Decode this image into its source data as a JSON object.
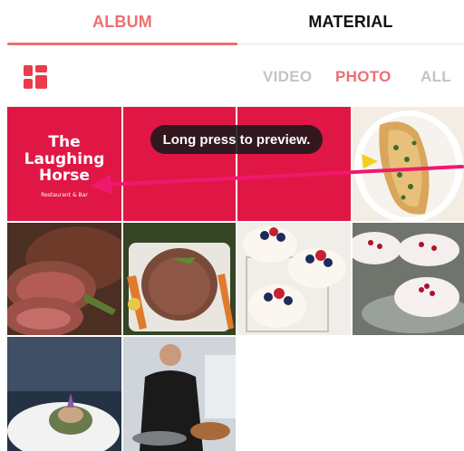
{
  "tabs": {
    "album": "ALBUM",
    "material": "MATERIAL",
    "active": "album"
  },
  "filters": {
    "video": "VIDEO",
    "photo": "PHOTO",
    "all": "ALL",
    "selected": "photo"
  },
  "tooltip": "Long press to preview.",
  "logo": {
    "line1": "The",
    "line2": "Laughing",
    "line3": "Horse",
    "tagline": "Restaurant & Bar"
  },
  "colors": {
    "accent": "#ec6f73",
    "brand_red": "#e01745",
    "icon_red": "#ec3b4b",
    "arrow": "#f0196e",
    "inactive": "#c4c4c4"
  },
  "icons": {
    "layout_toggle": "grid-layout-icon"
  },
  "grid": {
    "columns": 4,
    "items": [
      {
        "type": "photo",
        "subject": "logo-tile"
      },
      {
        "type": "photo",
        "subject": "red-tile"
      },
      {
        "type": "photo",
        "subject": "red-tile"
      },
      {
        "type": "photo",
        "subject": "grilled-fish"
      },
      {
        "type": "photo",
        "subject": "roast-beef"
      },
      {
        "type": "photo",
        "subject": "roast-with-vegetables"
      },
      {
        "type": "photo",
        "subject": "berry-pavlovas"
      },
      {
        "type": "photo",
        "subject": "pomegranate-meringues"
      },
      {
        "type": "photo",
        "subject": "plated-dish"
      },
      {
        "type": "photo",
        "subject": "chef-cooking"
      }
    ]
  }
}
